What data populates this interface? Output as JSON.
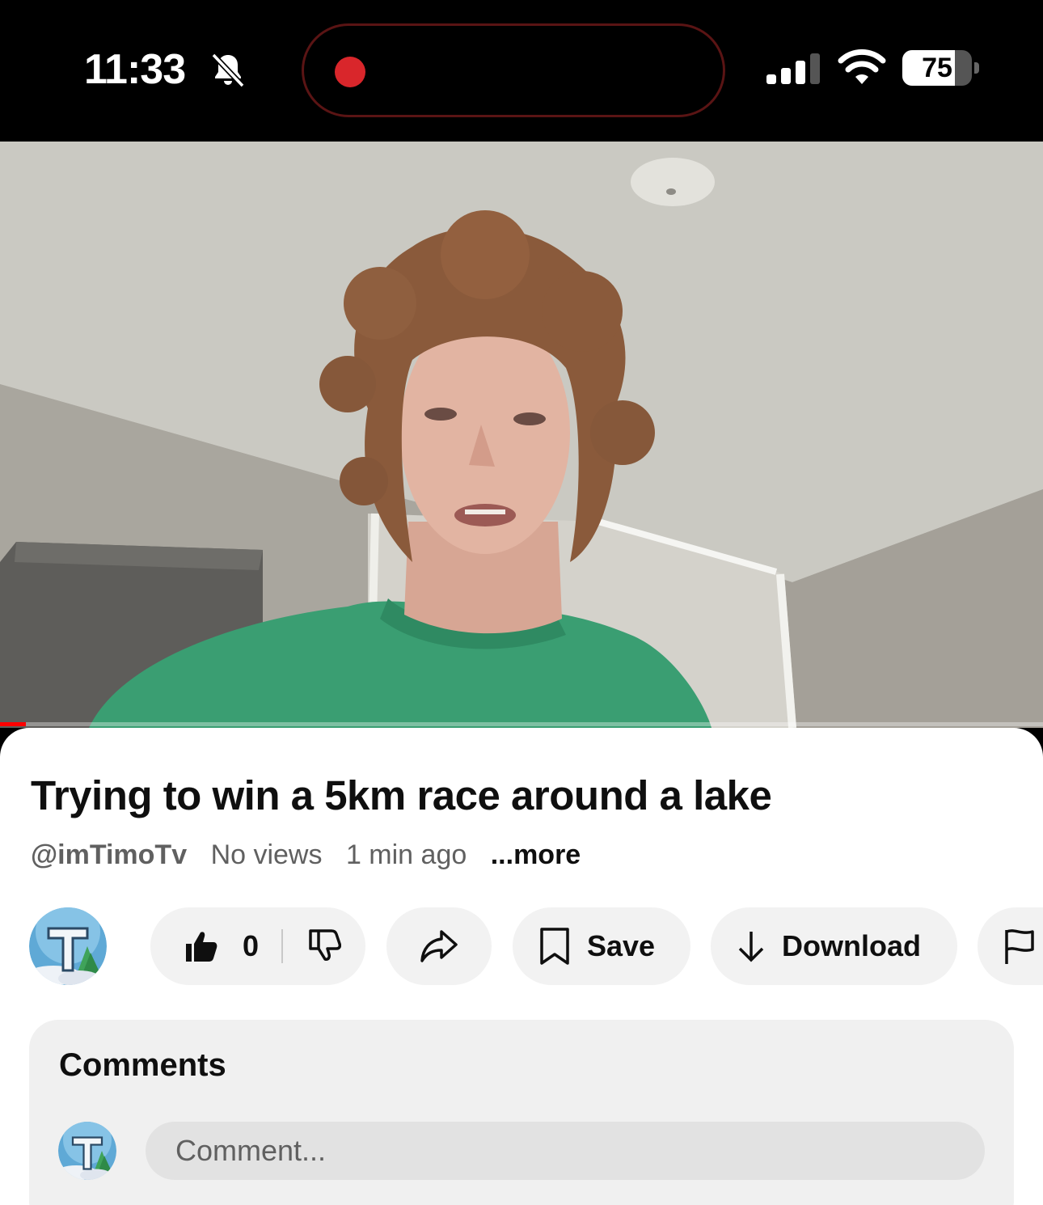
{
  "status_bar": {
    "time": "11:33",
    "battery_percent": "75",
    "battery_level": 0.75,
    "icons": [
      "bell-slash-icon",
      "recording-indicator",
      "cellular-signal-icon",
      "wifi-icon",
      "battery-icon"
    ]
  },
  "player": {
    "progress": 0.025,
    "progress_color": "#ff0000"
  },
  "video": {
    "title": "Trying to win a 5km race around a lake",
    "channel_handle": "@imTimoTv",
    "views": "No views",
    "age": "1 min ago",
    "more_label": "...more"
  },
  "actions": {
    "like_count": "0",
    "save_label": "Save",
    "download_label": "Download",
    "icons": [
      "thumbs-up-icon",
      "thumbs-down-icon",
      "share-icon",
      "bookmark-icon",
      "download-arrow-icon",
      "flag-icon"
    ]
  },
  "comments": {
    "title": "Comments",
    "placeholder": "Comment..."
  },
  "colors": {
    "accent_red": "#ff0000",
    "recording_red": "#d9262b",
    "pill_bg": "#f2f2f2",
    "text_primary": "#0f0f0f",
    "text_secondary": "#606060"
  }
}
